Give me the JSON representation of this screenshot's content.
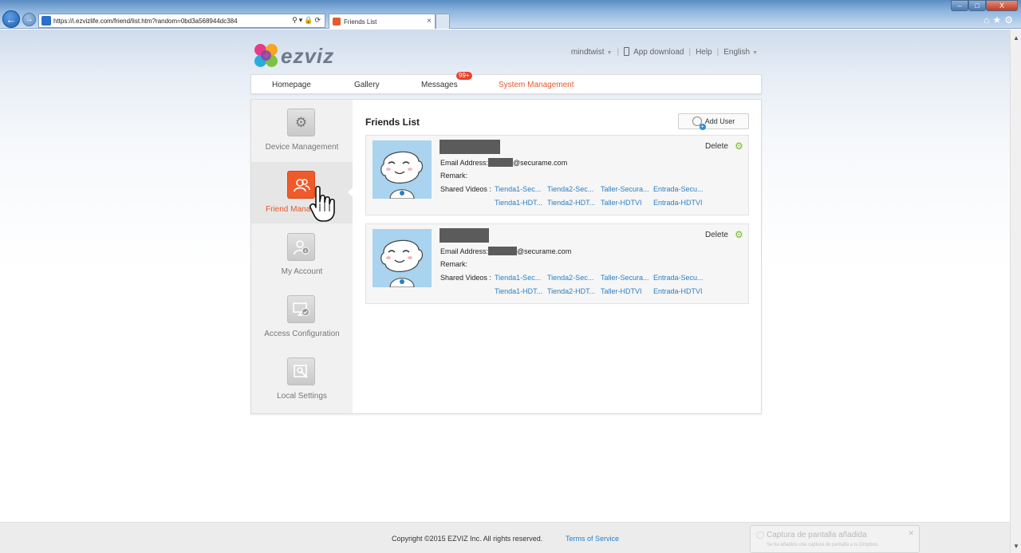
{
  "browser": {
    "url": "https://i.ezvizlife.com/friend/list.htm?random=0bd3a568944dc384",
    "tab_title": "Friends List",
    "tab_close": "×",
    "window_controls": {
      "minimize": "–",
      "maximize": "□",
      "close": "X"
    },
    "toolbar_icons": [
      "home-icon",
      "star-icon",
      "gear-icon"
    ]
  },
  "header": {
    "logo_text": "ezviz",
    "user": "mindtwist",
    "app_download": "App download",
    "help": "Help",
    "language": "English"
  },
  "menu": {
    "items": [
      "Homepage",
      "Gallery",
      "Messages",
      "System Management"
    ],
    "active": "System Management",
    "messages_badge": "99+"
  },
  "sidebar": {
    "items": [
      {
        "label": "Device Management",
        "icon": "gear-icon"
      },
      {
        "label": "Friend Management",
        "visible_label": "Friend Mana",
        "icon": "friends-icon"
      },
      {
        "label": "My Account",
        "icon": "account-icon"
      },
      {
        "label": "Access Configuration",
        "icon": "monitor-icon"
      },
      {
        "label": "Local Settings",
        "icon": "settings-icon"
      }
    ],
    "active_index": 1
  },
  "main": {
    "title": "Friends List",
    "add_user": "Add User",
    "friends": [
      {
        "email_label": "Email Address:",
        "email_domain": "@securame.com",
        "remark_label": "Remark:",
        "shared_label": "Shared Videos :",
        "delete": "Delete",
        "videos_row1": [
          "Tienda1-Sec...",
          "Tienda2-Sec...",
          "Taller-Secura...",
          "Entrada-Secu..."
        ],
        "videos_row2": [
          "Tienda1-HDT...",
          "Tienda2-HDT...",
          "Taller-HDTVI",
          "Entrada-HDTVI"
        ]
      },
      {
        "email_label": "Email Address:",
        "email_domain": "@securame.com",
        "remark_label": "Remark:",
        "shared_label": "Shared Videos :",
        "delete": "Delete",
        "videos_row1": [
          "Tienda1-Sec...",
          "Tienda2-Sec...",
          "Taller-Secura...",
          "Entrada-Secu..."
        ],
        "videos_row2": [
          "Tienda1-HDT...",
          "Tienda2-HDT...",
          "Taller-HDTVI",
          "Entrada-HDTVI"
        ]
      }
    ]
  },
  "footer": {
    "copyright": "Copyright ©2015 EZVIZ Inc. All rights reserved.",
    "terms": "Terms of Service"
  },
  "toast": {
    "title": "Captura de pantalla añadida",
    "body": "Se ha añadido una captura de pantalla a tu Dropbox."
  }
}
